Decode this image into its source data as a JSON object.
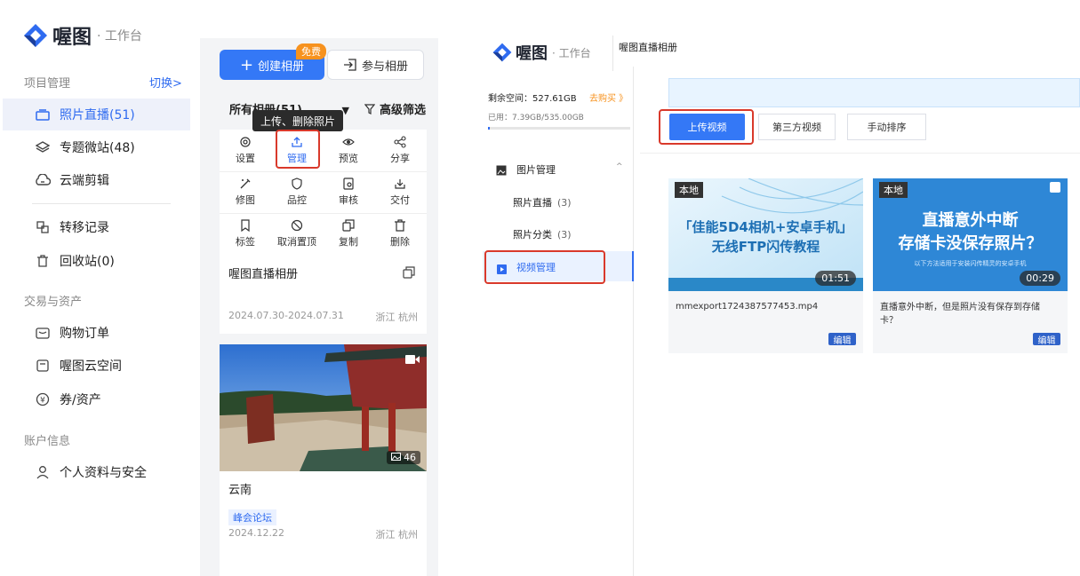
{
  "brand": {
    "name": "喔图",
    "subtitle": "· 工作台"
  },
  "left": {
    "project_section": "项目管理",
    "switch_link": "切换>",
    "nav_project": [
      {
        "label": "照片直播(51)",
        "icon": "album-icon",
        "active": true
      },
      {
        "label": "专题微站(48)",
        "icon": "layers-icon"
      },
      {
        "label": "云端剪辑",
        "icon": "cloud-edit-icon"
      },
      {
        "label": "转移记录",
        "icon": "transfer-icon"
      },
      {
        "label": "回收站(0)",
        "icon": "trash-icon"
      }
    ],
    "trade_section": "交易与资产",
    "nav_trade": [
      {
        "label": "购物订单",
        "icon": "order-icon"
      },
      {
        "label": "喔图云空间",
        "icon": "cloud-space-icon"
      },
      {
        "label": "券/资产",
        "icon": "coupon-icon"
      }
    ],
    "account_section": "账户信息",
    "nav_account": [
      {
        "label": "个人资料与安全",
        "icon": "user-icon"
      }
    ]
  },
  "middle": {
    "create_button": "创建相册",
    "free_badge": "免费",
    "join_button": "参与相册",
    "album_filter": "所有相册(51)",
    "advanced_filter": "高级筛选",
    "tooltip": "上传、删除照片",
    "operations": [
      "设置",
      "管理",
      "预览",
      "分享",
      "修图",
      "品控",
      "审核",
      "交付",
      "标签",
      "取消置顶",
      "复制",
      "删除"
    ],
    "album1": {
      "title": "喔图直播相册",
      "dates": "2024.07.30-2024.07.31",
      "location": "浙江 杭州"
    },
    "album2": {
      "title": "云南",
      "tag": "峰会论坛",
      "date": "2024.12.22",
      "location": "浙江 杭州",
      "photo_count": "46"
    }
  },
  "right": {
    "brand": {
      "name": "喔图",
      "subtitle": "· 工作台"
    },
    "album_title": "喔图直播相册",
    "storage_label": "剩余空间：",
    "storage_value": "527.61GB",
    "buy_link": "去购买 》",
    "used_text": "已用：7.39GB/535.00GB",
    "storage_used_fraction": 0.0138,
    "menu_group": "图片管理",
    "menu_items": [
      {
        "label": "照片直播",
        "count": "(3)"
      },
      {
        "label": "照片分类",
        "count": "(3)"
      }
    ],
    "video_menu": "视频管理",
    "buttons": {
      "upload": "上传视频",
      "third_party": "第三方视频",
      "sort": "手动排序"
    },
    "videos": [
      {
        "tag": "本地",
        "headline1": "「佳能5D4相机+安卓手机」",
        "headline2": "无线FTP闪传教程",
        "duration": "01:51",
        "name": "mmexport1724387577453.mp4",
        "edit": "编辑"
      },
      {
        "tag": "本地",
        "headline1": "直播意外中断",
        "headline2": "存储卡没保存照片？",
        "caption": "以下方法适用于安装闪传精灵的安卓手机",
        "duration": "00:29",
        "name": "直播意外中断，但是照片没有保存到存储卡？",
        "edit": "编辑"
      }
    ]
  },
  "colors": {
    "accent": "#3478f6",
    "highlight_red": "#d9392b",
    "edit_blue": "#2f62c9",
    "badge_orange": "#f7921e"
  }
}
